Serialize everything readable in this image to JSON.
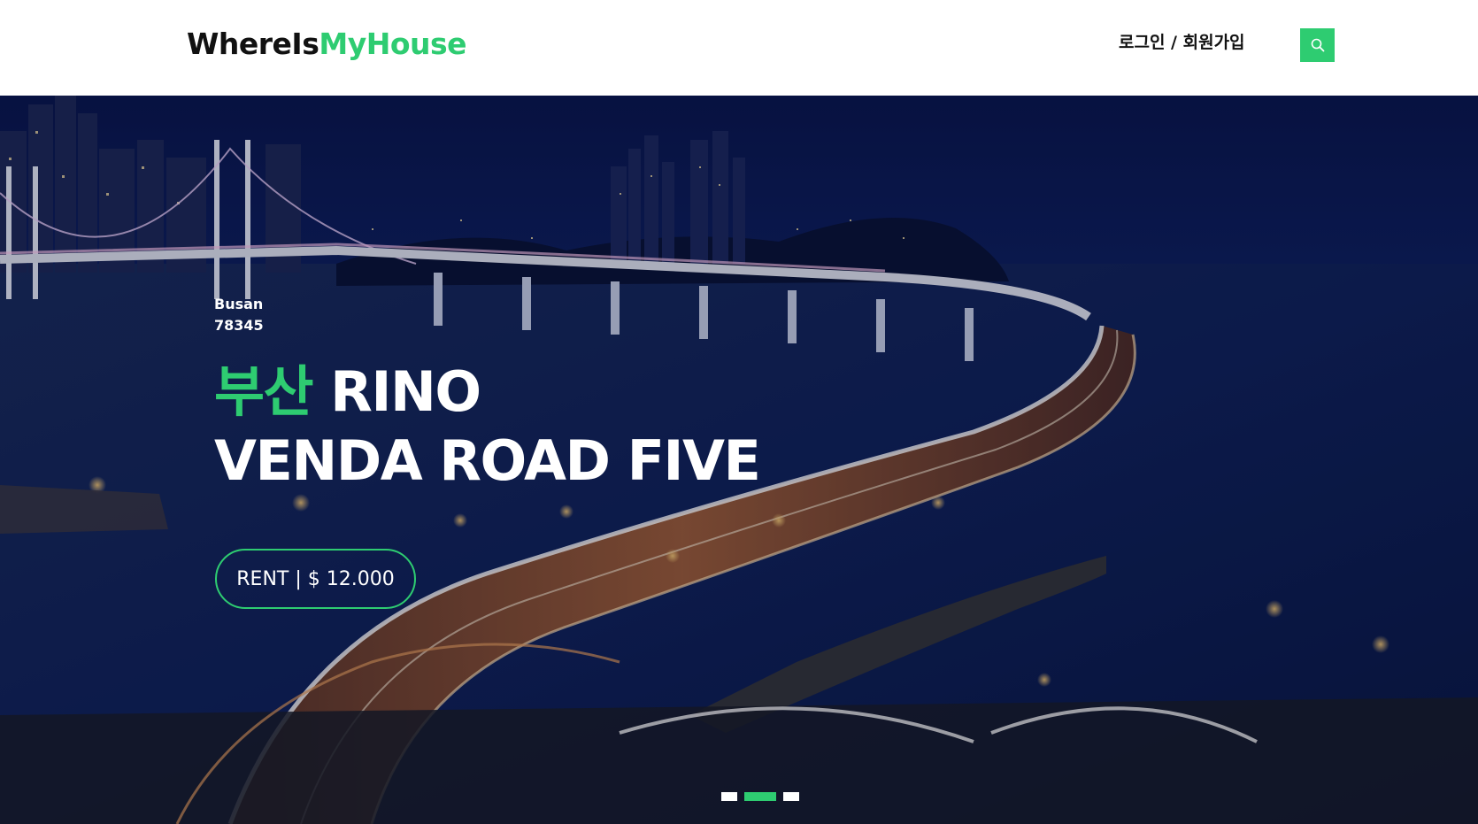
{
  "header": {
    "logo_part1": "WhereIs",
    "logo_part2": "MyHouse",
    "login_label": "로그인 / 회원가입"
  },
  "hero": {
    "location_city": "Busan",
    "location_zip": "78345",
    "title_accent": "부산",
    "title_rest_line1": " RINO",
    "title_line2": "VENDA ROAD FIVE",
    "price_button": "RENT | $ 12.000"
  },
  "carousel": {
    "slide_count": 3,
    "active_index": 1
  },
  "colors": {
    "accent": "#2ecc71",
    "text_dark": "#111111",
    "night_sky": "#0d1f5e"
  },
  "icons": {
    "search": "search-icon"
  }
}
